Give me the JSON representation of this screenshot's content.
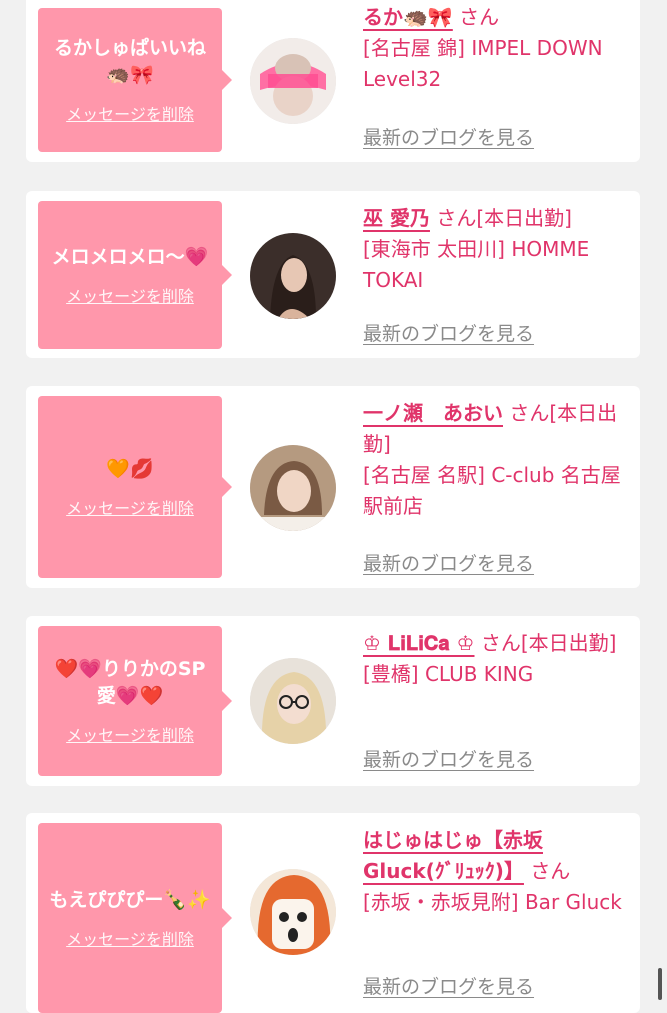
{
  "entries": [
    {
      "message": "るかしゅぱいいね🦔🎀",
      "delete_label": "メッセージを削除",
      "name": "るか🦔🎀",
      "suffix": "さん",
      "shop": "[名古屋 錦] IMPEL DOWN Level32",
      "blog_label": "最新のブログを見る",
      "avatar_icon": "profile-photo"
    },
    {
      "message": "メロメロメロ〜💗",
      "delete_label": "メッセージを削除",
      "name": "巫 愛乃",
      "suffix": "さん[本日出勤]",
      "shop": "[東海市 太田川] HOMME TOKAI",
      "blog_label": "最新のブログを見る",
      "avatar_icon": "profile-photo"
    },
    {
      "message": "🧡💋",
      "delete_label": "メッセージを削除",
      "name": "一ノ瀬　あおい",
      "suffix": "さん[本日出勤]",
      "shop": "[名古屋 名駅] C-club 名古屋駅前店",
      "blog_label": "最新のブログを見る",
      "avatar_icon": "profile-photo"
    },
    {
      "message": "❤️💗りりかのSP愛💗❤️",
      "delete_label": "メッセージを削除",
      "name": "♔ 𝐋𝐢𝐋𝐢𝐂𝐚 ♔",
      "suffix": "さん[本日出勤]",
      "shop": "[豊橋] CLUB KING",
      "blog_label": "最新のブログを見る",
      "avatar_icon": "profile-photo"
    },
    {
      "message": "もえぴぴぴー🍾✨",
      "delete_label": "メッセージを削除",
      "name": "はじゅはじゅ【赤坂Gluck(ｸﾞﾘｭｯｸ)】",
      "suffix": "さん",
      "shop": "[赤坂・赤坂見附] Bar Gluck",
      "blog_label": "最新のブログを見る",
      "avatar_icon": "profile-photo"
    }
  ],
  "colors": {
    "bubble": "#ff97ab",
    "accent": "#e0346a",
    "muted": "#8a8a8a",
    "background": "#f1f1f1"
  }
}
